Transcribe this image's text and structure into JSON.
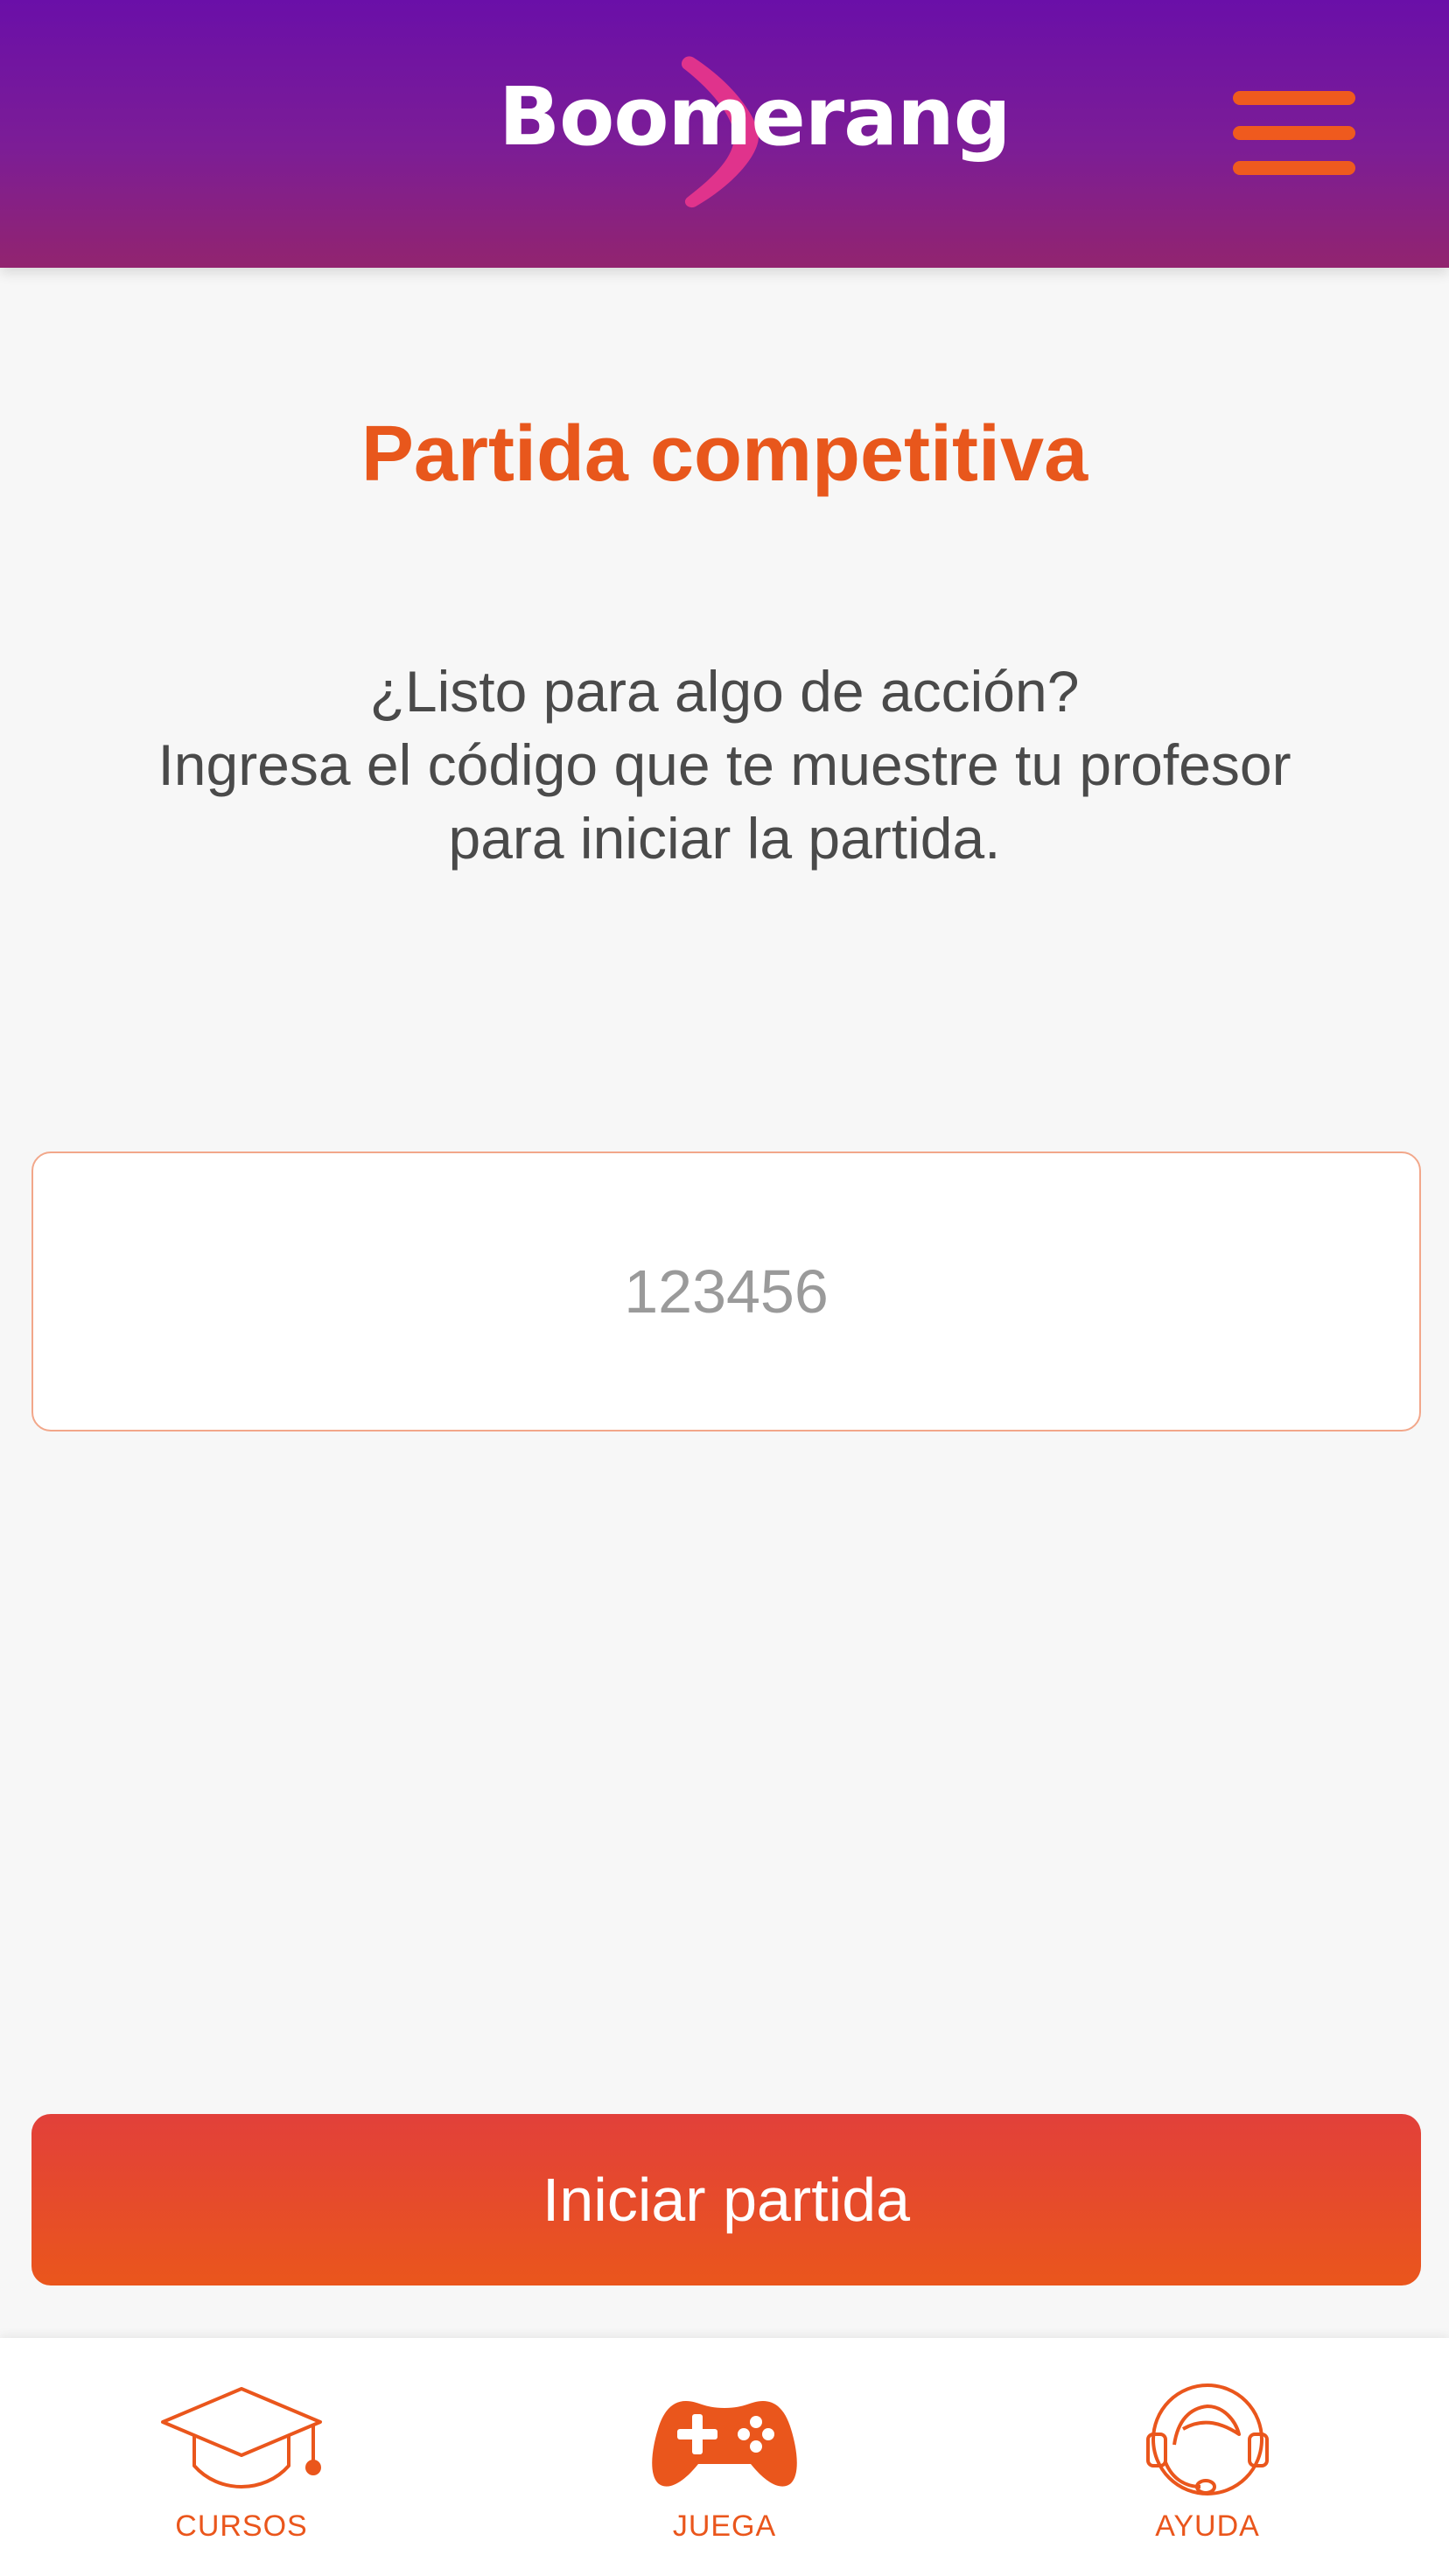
{
  "header": {
    "logo_text": "Boomerang",
    "menu_icon": "hamburger-menu-icon"
  },
  "main": {
    "title": "Partida competitiva",
    "description_lines": [
      "¿Listo para algo de acción?",
      "Ingresa el código que te muestre tu profesor",
      "para iniciar la partida."
    ],
    "code_input": {
      "value": "",
      "placeholder": "123456"
    },
    "start_button_label": "Iniciar partida"
  },
  "bottom_nav": {
    "items": [
      {
        "label": "CURSOS",
        "icon": "graduation-cap-icon"
      },
      {
        "label": "JUEGA",
        "icon": "gamepad-icon"
      },
      {
        "label": "AYUDA",
        "icon": "headset-support-icon"
      }
    ]
  },
  "colors": {
    "accent": "#ea561c",
    "header_top": "#6a0fa8",
    "header_bottom": "#92246f",
    "logo_mark": "#e0338c",
    "background": "#f7f7f7"
  }
}
